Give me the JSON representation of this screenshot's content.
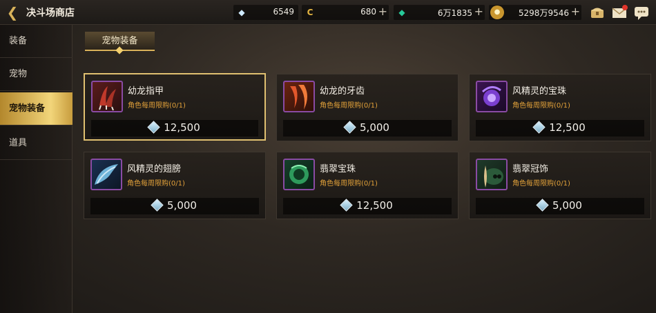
{
  "header": {
    "title": "决斗场商店",
    "currencies": [
      {
        "icon": "crystal-icon",
        "value": "6549",
        "has_plus": false
      },
      {
        "icon": "gold-c-coin-icon",
        "value": "680",
        "has_plus": true
      },
      {
        "icon": "emerald-icon",
        "value": "6万1835",
        "has_plus": true
      },
      {
        "icon": "gold-coin-icon",
        "value": "5298万9546",
        "has_plus": true
      }
    ],
    "plus_glyph": "+"
  },
  "sidebar": {
    "items": [
      {
        "label": "装备",
        "active": false
      },
      {
        "label": "宠物",
        "active": false
      },
      {
        "label": "宠物装备",
        "active": true
      },
      {
        "label": "道具",
        "active": false
      }
    ]
  },
  "tab": {
    "label": "宠物装备"
  },
  "shop": {
    "items": [
      {
        "name": "幼龙指甲",
        "limit": "角色每周限购(0/1)",
        "price": "12,500",
        "icon": "dragon-claw-icon",
        "selected": true
      },
      {
        "name": "幼龙的牙齿",
        "limit": "角色每周限购(0/1)",
        "price": "5,000",
        "icon": "dragon-tooth-icon",
        "selected": false
      },
      {
        "name": "风精灵的宝珠",
        "limit": "角色每周限购(0/1)",
        "price": "12,500",
        "icon": "wind-orb-icon",
        "selected": false
      },
      {
        "name": "风精灵的翅膀",
        "limit": "角色每周限购(0/1)",
        "price": "5,000",
        "icon": "wind-wing-icon",
        "selected": false
      },
      {
        "name": "翡翠宝珠",
        "limit": "角色每周限购(0/1)",
        "price": "12,500",
        "icon": "jade-orb-icon",
        "selected": false
      },
      {
        "name": "翡翠冠饰",
        "limit": "角色每周限购(0/1)",
        "price": "5,000",
        "icon": "jade-crown-icon",
        "selected": false
      }
    ]
  },
  "colors": {
    "accent": "#e1c171",
    "limit_text": "#e3a23a",
    "active_tab": "#f2d57a"
  }
}
